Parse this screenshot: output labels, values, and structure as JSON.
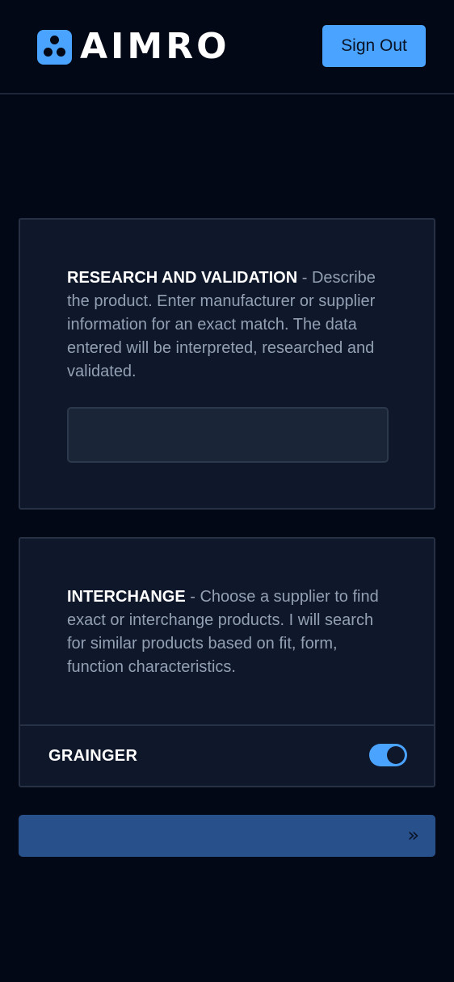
{
  "header": {
    "brand": "AIMRO",
    "sign_out_label": "Sign Out"
  },
  "research": {
    "title": "RESEARCH AND VALIDATION",
    "description": " - Describe the product. Enter manufacturer or supplier information for an exact match. The data entered will be interpreted, researched and validated.",
    "input_value": ""
  },
  "interchange": {
    "title": "INTERCHANGE",
    "description": " - Choose a supplier to find exact or interchange products. I will search for similar products based on fit, form, function characteristics.",
    "supplier": {
      "label": "GRAINGER",
      "enabled": true
    }
  },
  "submit": {
    "icon": "double-chevron-right-icon",
    "glyph": "»"
  },
  "colors": {
    "background": "#030816",
    "card": "#0f172a",
    "accent": "#4aa3ff",
    "submit": "#28518c"
  }
}
